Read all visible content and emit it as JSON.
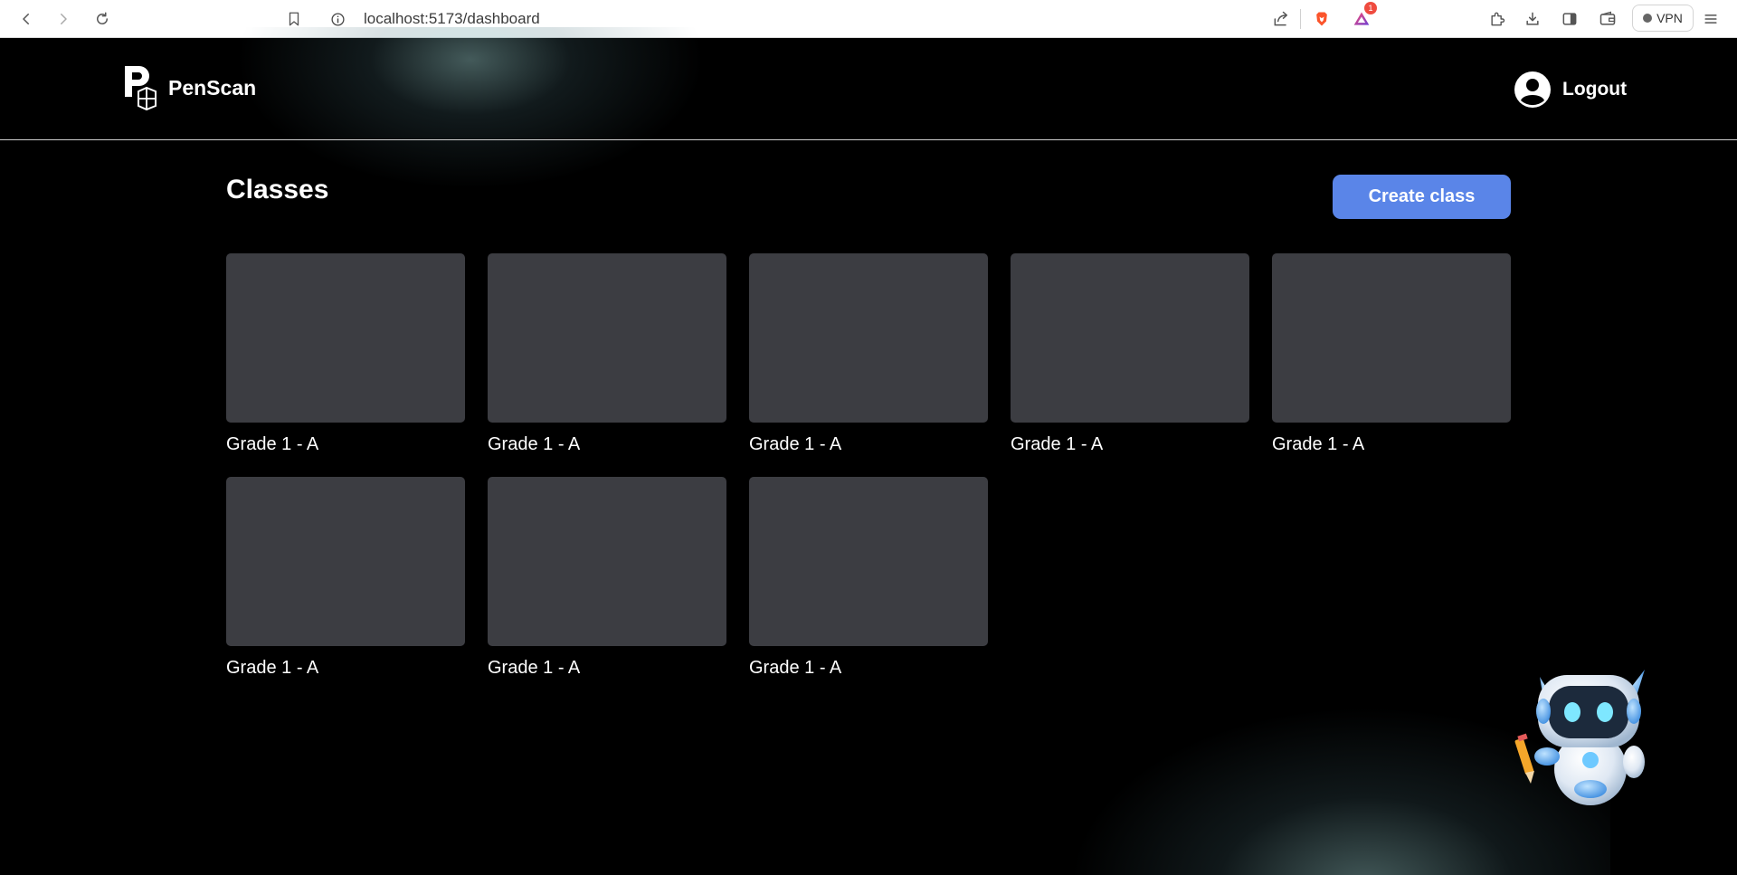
{
  "browser": {
    "url": "localhost:5173/dashboard",
    "vpn_label": "VPN",
    "notification_count": "1"
  },
  "app": {
    "name": "PenScan",
    "logout_label": "Logout"
  },
  "main": {
    "title": "Classes",
    "create_button_label": "Create class",
    "classes": [
      {
        "name": "Grade 1 - A"
      },
      {
        "name": "Grade 1 - A"
      },
      {
        "name": "Grade 1 - A"
      },
      {
        "name": "Grade 1 - A"
      },
      {
        "name": "Grade 1 - A"
      },
      {
        "name": "Grade 1 - A"
      },
      {
        "name": "Grade 1 - A"
      },
      {
        "name": "Grade 1 - A"
      }
    ]
  },
  "colors": {
    "background": "#000000",
    "accent": "#5a85e8",
    "card": "#3c3d42"
  },
  "icons": {
    "back": "arrow-left-icon",
    "forward": "arrow-right-icon",
    "reload": "reload-icon",
    "bookmark": "bookmark-icon",
    "info": "info-icon",
    "share": "share-icon",
    "brave": "brave-lion-icon",
    "rewards": "triangle-rewards-icon",
    "extensions": "puzzle-icon",
    "download": "download-icon",
    "sidebar": "sidebar-icon",
    "wallet": "wallet-icon",
    "menu": "hamburger-menu-icon",
    "user": "user-icon",
    "assistant": "robot-icon"
  }
}
